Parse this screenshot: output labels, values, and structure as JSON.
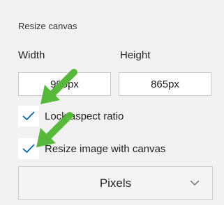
{
  "panel": {
    "heading": "Resize canvas",
    "width_label": "Width",
    "height_label": "Height",
    "width_value": "900px",
    "height_value": "865px",
    "lock_aspect_ratio": {
      "label": "Lock aspect ratio",
      "checked": true
    },
    "resize_image": {
      "label": "Resize image with canvas",
      "checked": true
    },
    "unit_select": {
      "value": "Pixels"
    }
  },
  "colors": {
    "accent": "#0067c0",
    "annotation_arrow": "#57b93a"
  }
}
